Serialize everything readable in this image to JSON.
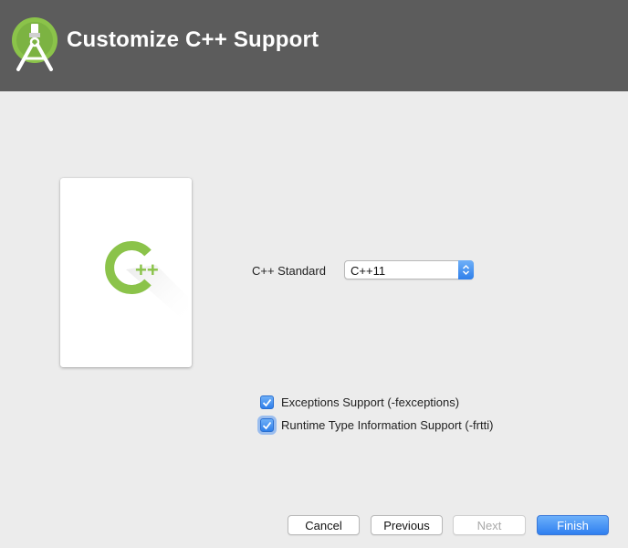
{
  "header": {
    "title": "Customize C++ Support",
    "background": "#5c5c5c",
    "logo_icon": "android-studio-icon"
  },
  "card": {
    "logo_icon": "cpp-logo-icon",
    "logo_color": "#8bc34a"
  },
  "form": {
    "standard_label": "C++ Standard",
    "standard_value": "C++11",
    "exceptions_label": "Exceptions Support (-fexceptions)",
    "exceptions_checked": true,
    "rtti_label": "Runtime Type Information Support (-frtti)",
    "rtti_checked": true
  },
  "buttons": {
    "cancel": "Cancel",
    "previous": "Previous",
    "next": "Next",
    "finish": "Finish"
  },
  "colors": {
    "accent": "#2f7fea",
    "window_bg": "#ececec"
  }
}
